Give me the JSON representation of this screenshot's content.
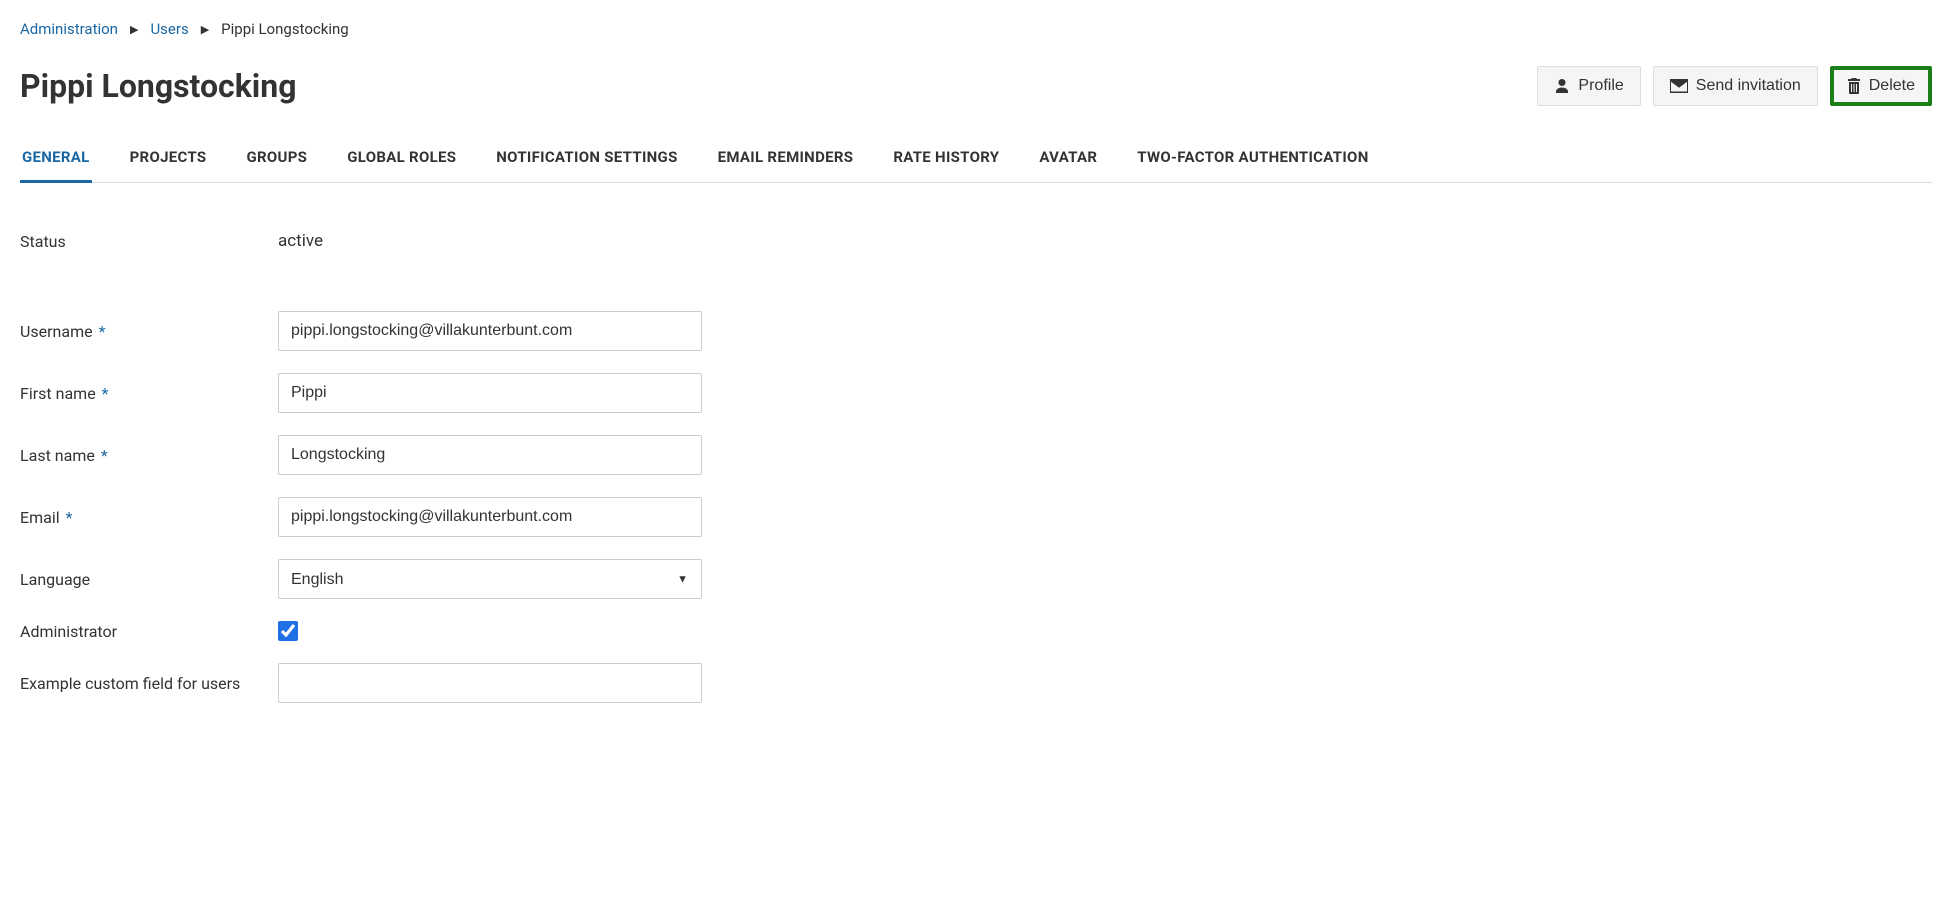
{
  "breadcrumb": {
    "administration": "Administration",
    "users": "Users",
    "current": "Pippi Longstocking"
  },
  "page_title": "Pippi Longstocking",
  "actions": {
    "profile": "Profile",
    "send_invitation": "Send invitation",
    "delete": "Delete"
  },
  "tabs": {
    "general": "GENERAL",
    "projects": "PROJECTS",
    "groups": "GROUPS",
    "global_roles": "GLOBAL ROLES",
    "notification_settings": "NOTIFICATION SETTINGS",
    "email_reminders": "EMAIL REMINDERS",
    "rate_history": "RATE HISTORY",
    "avatar": "AVATAR",
    "two_factor": "TWO-FACTOR AUTHENTICATION"
  },
  "form": {
    "status_label": "Status",
    "status_value": "active",
    "username_label": "Username",
    "username_value": "pippi.longstocking@villakunterbunt.com",
    "firstname_label": "First name",
    "firstname_value": "Pippi",
    "lastname_label": "Last name",
    "lastname_value": "Longstocking",
    "email_label": "Email",
    "email_value": "pippi.longstocking@villakunterbunt.com",
    "language_label": "Language",
    "language_value": "English",
    "administrator_label": "Administrator",
    "administrator_checked": true,
    "custom_field_label": "Example custom field for users",
    "custom_field_value": ""
  }
}
